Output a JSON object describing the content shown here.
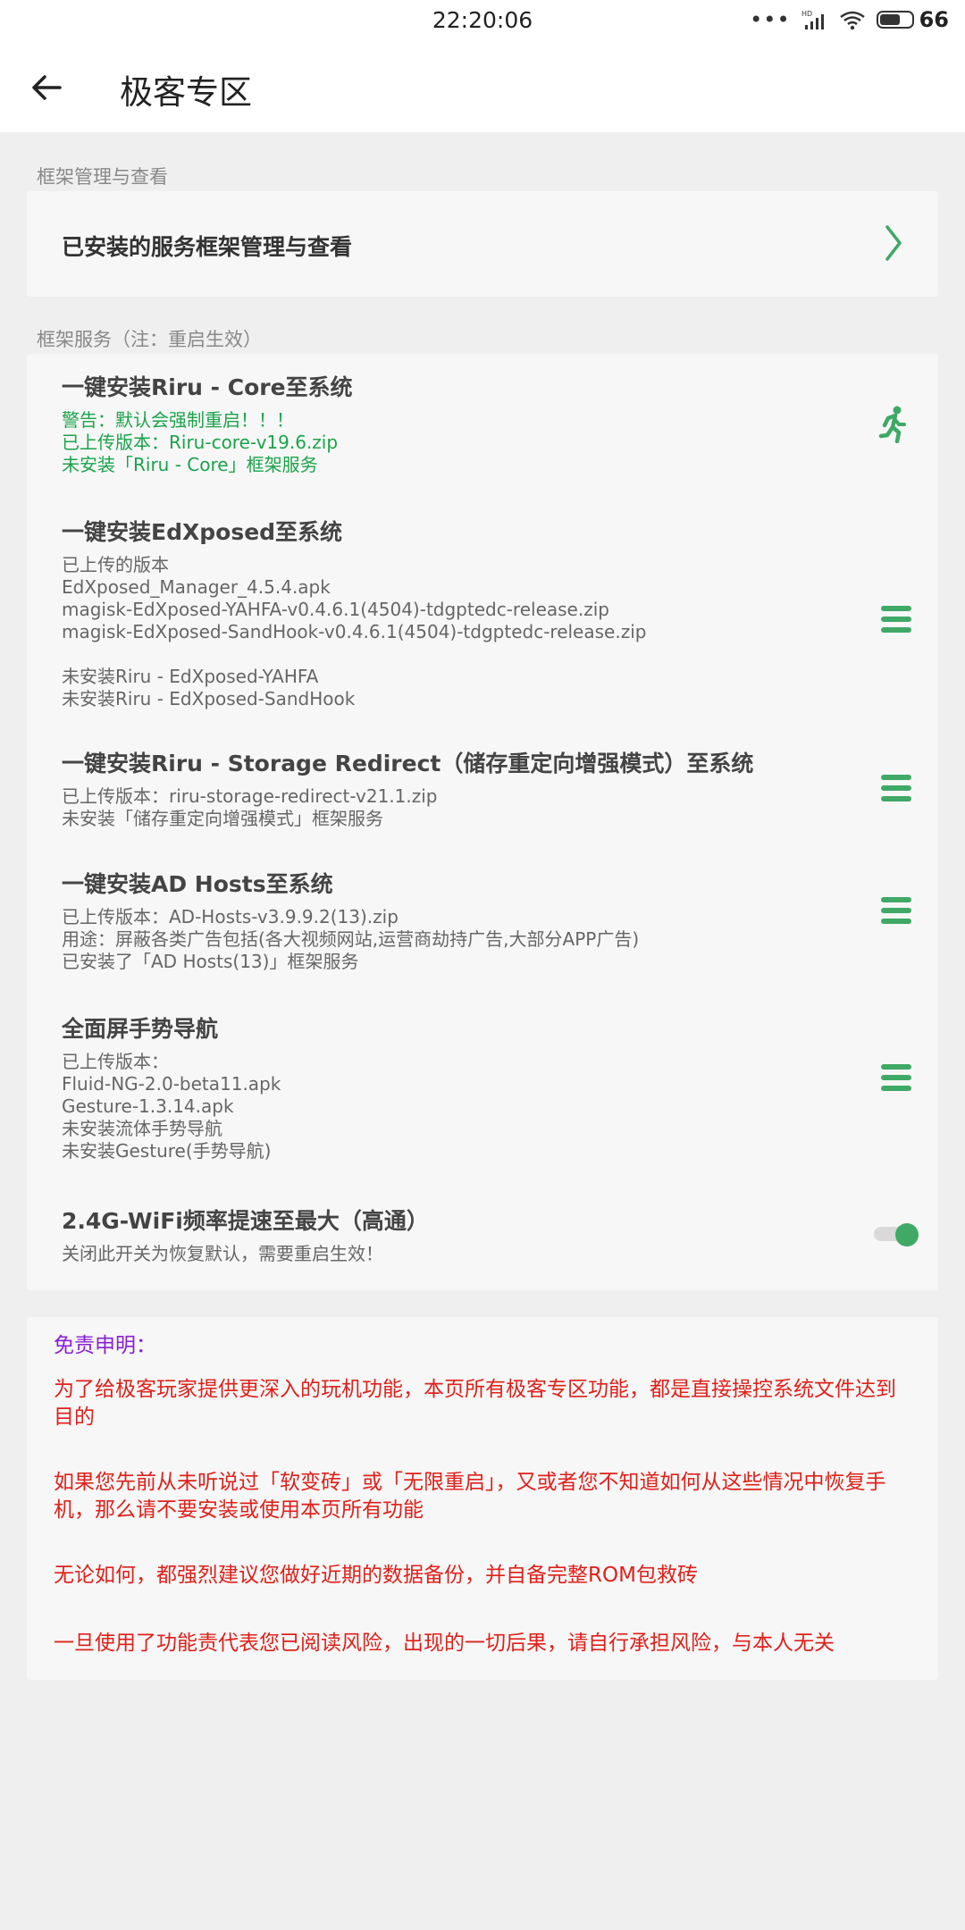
{
  "status_bar": {
    "time": "22:20:06",
    "battery_level": "66",
    "icons": [
      "more-dots-icon",
      "signal-hd-icon",
      "wifi-icon",
      "battery-icon"
    ]
  },
  "app_bar": {
    "title": "极客专区",
    "back_icon": "arrow-left-icon"
  },
  "sections": {
    "framework_mgmt": {
      "label": "框架管理与查看",
      "nav_item": "已安装的服务框架管理与查看"
    },
    "framework_services": {
      "label": "框架服务（注：重启生效）",
      "items": [
        {
          "title": "一键安装Riru - Core至系统",
          "desc": "警告：默认会强制重启！！！\n已上传版本：Riru-core-v19.6.zip\n未安装「Riru - Core」框架服务"
        },
        {
          "title": "一键安装EdXposed至系统",
          "desc": "已上传的版本\nEdXposed_Manager_4.5.4.apk\nmagisk-EdXposed-YAHFA-v0.4.6.1(4504)-tdgptedc-release.zip\nmagisk-EdXposed-SandHook-v0.4.6.1(4504)-tdgptedc-release.zip\n\n未安装Riru - EdXposed-YAHFA\n未安装Riru - EdXposed-SandHook"
        },
        {
          "title": "一键安装Riru - Storage Redirect（储存重定向增强模式）至系统",
          "desc": "已上传版本：riru-storage-redirect-v21.1.zip\n未安装「储存重定向增强模式」框架服务"
        },
        {
          "title": "一键安装AD Hosts至系统",
          "desc": "已上传版本：AD-Hosts-v3.9.9.2(13).zip\n用途：屏蔽各类广告包括(各大视频网站,运营商劫持广告,大部分APP广告)\n已安装了「AD Hosts(13)」框架服务"
        },
        {
          "title": "全面屏手势导航",
          "desc": "已上传版本：\nFluid-NG-2.0-beta11.apk\nGesture-1.3.14.apk\n未安装流体手势导航\n未安装Gesture(手势导航)"
        },
        {
          "title": "2.4G-WiFi频率提速至最大（高通）",
          "desc": "关闭此开关为恢复默认，需要重启生效！",
          "toggle_on": true
        }
      ]
    }
  },
  "disclaimer": {
    "title": "免责申明：",
    "paragraphs": [
      "为了给极客玩家提供更深入的玩机功能，本页所有极客专区功能，都是直接操控系统文件达到目的",
      "如果您先前从未听说过「软变砖」或「无限重启」，又或者您不知道如何从这些情况中恢复手机，那么请不要安装或使用本页所有功能",
      "无论如何，都强烈建议您做好近期的数据备份，并自备完整ROM包救砖",
      "一旦使用了功能责代表您已阅读风险，出现的一切后果，请自行承担风险，与本人无关"
    ]
  },
  "colors": {
    "accent_green": "#3fa966",
    "warning_green": "#1aa34a",
    "disclaimer_red": "#e0201a",
    "disclaimer_title_purple": "#8a20d6"
  }
}
